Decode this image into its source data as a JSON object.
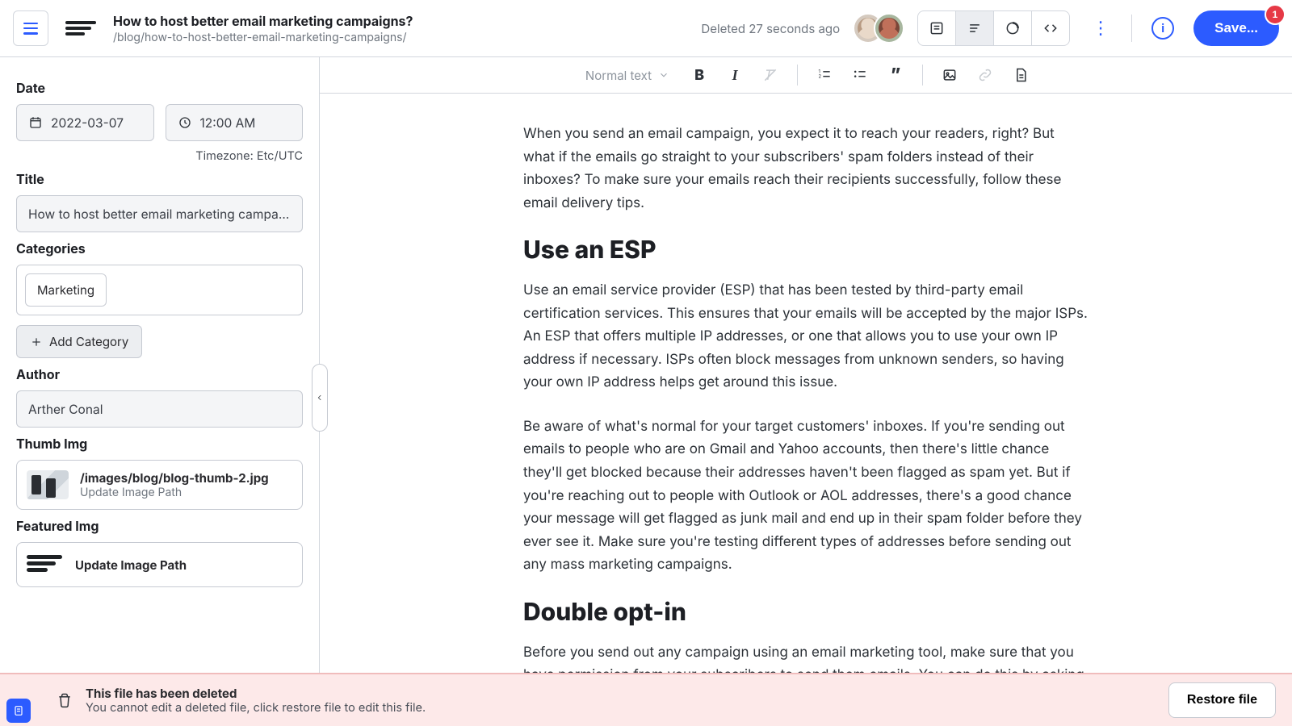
{
  "header": {
    "title": "How to host better email marketing campaigns?",
    "path": "/blog/how-to-host-better-email-marketing-campaigns/",
    "status": "Deleted 27 seconds ago",
    "save_label": "Save...",
    "save_badge_count": "1",
    "icons": {
      "menu": "hamburger-icon",
      "logo": "app-logo",
      "view_content": "content-view-icon",
      "view_outline": "outline-view-icon",
      "view_status": "status-dashboard-icon",
      "view_code": "code-view-icon",
      "more": "more-vertical-icon",
      "info": "info-icon"
    },
    "avatars": [
      "user-1",
      "user-2"
    ]
  },
  "sidebar": {
    "date_label": "Date",
    "date_value": "2022-03-07",
    "time_value": "12:00 AM",
    "timezone": "Timezone: Etc/UTC",
    "title_label": "Title",
    "title_value": "How to host better email marketing campaigns?",
    "categories_label": "Categories",
    "categories": [
      "Marketing"
    ],
    "add_category_label": "Add Category",
    "author_label": "Author",
    "author_value": "Arther Conal",
    "thumb_label": "Thumb Img",
    "thumb_path": "/images/blog/blog-thumb-2.jpg",
    "thumb_sub": "Update Image Path",
    "featured_label": "Featured Img",
    "featured_action": "Update Image Path"
  },
  "editor_toolbar": {
    "style_selector": "Normal text",
    "icons": {
      "bold": "bold-icon",
      "italic": "italic-icon",
      "clear_format": "clear-format-icon",
      "list_ordered": "ordered-list-icon",
      "list_unordered": "unordered-list-icon",
      "quote": "blockquote-icon",
      "image": "image-icon",
      "link": "link-icon",
      "snippet": "snippet-icon"
    }
  },
  "document": {
    "p1": "When you send an email campaign, you expect it to reach your readers, right? But what if the emails go straight to your subscribers' spam folders instead of their inboxes? To make sure your emails reach their recipients successfully, follow these email delivery tips.",
    "h2_1": "Use an ESP",
    "p2": "Use an email service provider (ESP) that has been tested by third-party email certification services. This ensures that your emails will be accepted by the major ISPs. An ESP that offers multiple IP addresses, or one that allows you to use your own IP address if necessary. ISPs often block messages from unknown senders, so having your own IP address helps get around this issue.",
    "p3": "Be aware of what's normal for your target customers' inboxes. If you're sending out emails to people who are on Gmail and Yahoo accounts, then there's little chance they'll get blocked because their addresses haven't been flagged as spam yet. But if you're reaching out to people with Outlook or AOL addresses, there's a good chance your message will get flagged as junk mail and end up in their spam folder before they ever see it. Make sure you're testing different types of addresses before sending out any mass marketing campaigns.",
    "h2_2": "Double opt-in",
    "p4": "Before you send out any campaign using an email marketing tool, make sure that you have permission from your subscribers to send them emails. You can do this by asking"
  },
  "deleted_banner": {
    "title": "This file has been deleted",
    "subtitle": "You cannot edit a deleted file, click restore file to edit this file.",
    "restore_label": "Restore file"
  }
}
